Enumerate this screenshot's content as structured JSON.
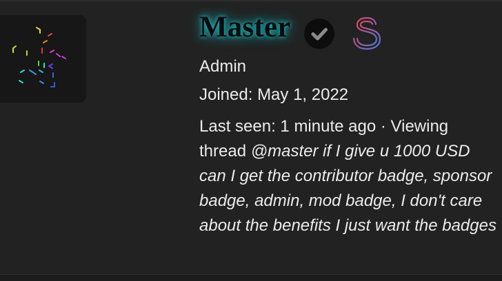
{
  "profile": {
    "username": "Master",
    "role": "Admin",
    "joined_label": "Joined:",
    "joined_date": "May 1, 2022",
    "last_seen_label": "Last seen:",
    "last_seen_value": "1 minute ago",
    "separator": "·",
    "activity_prefix": "Viewing thread",
    "thread_title": "@master if I give u 1000 USD can I get the contributor badge, sponsor badge, admin, mod badge, I don't care about the benefits I just want the badges"
  },
  "icons": {
    "verified": "check-circle-icon",
    "sponsor": "dollar-sign-icon",
    "avatar": "geometric-logo"
  },
  "colors": {
    "background": "#222222",
    "username_glow": "#18c4cc",
    "text": "#ececec",
    "verified_bg": "#0d0d0d",
    "verified_check": "#8a8a8a",
    "sponsor_gradient_start": "#e0485a",
    "sponsor_gradient_end": "#4a7bdc"
  }
}
